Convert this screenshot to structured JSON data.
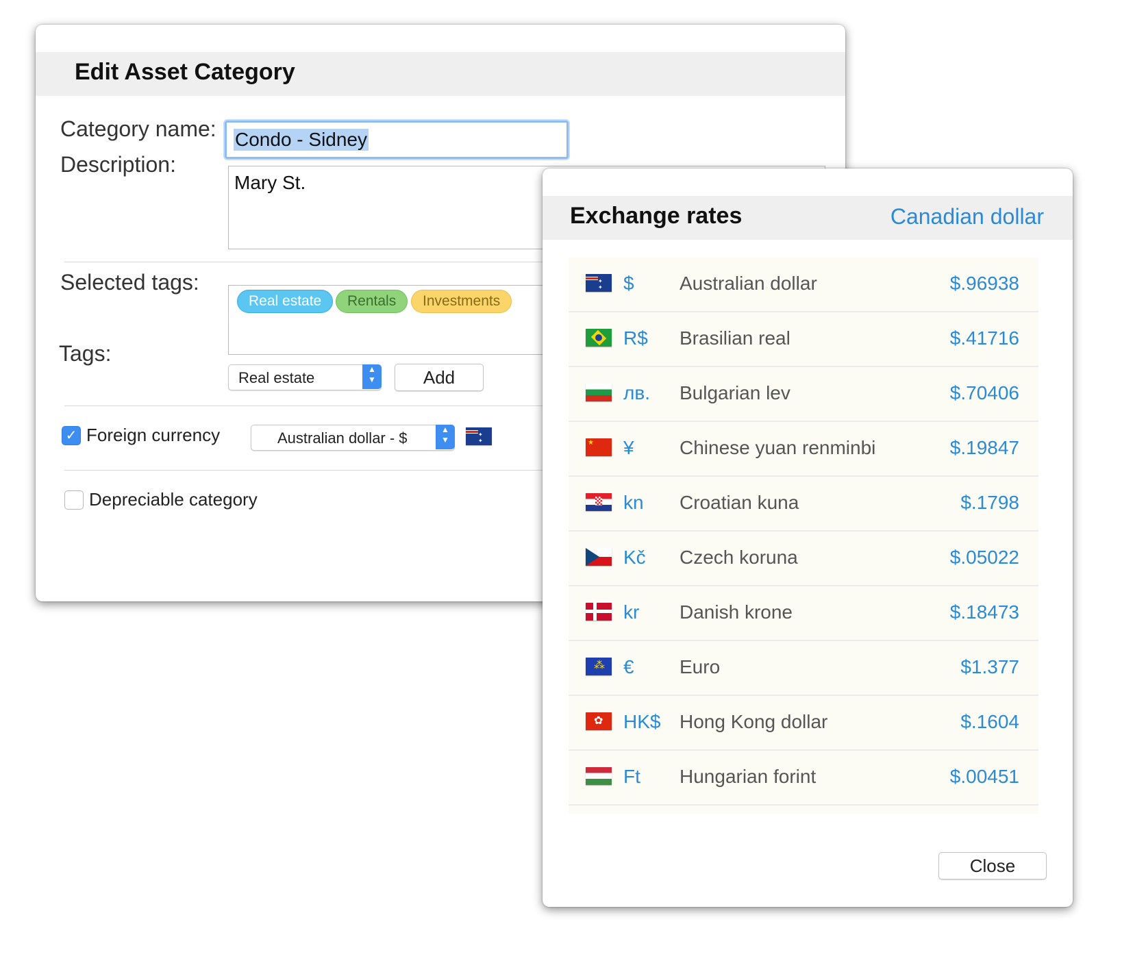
{
  "edit_dialog": {
    "title": "Edit Asset Category",
    "category_name_label": "Category name:",
    "category_name_value": "Condo - Sidney",
    "description_label": "Description:",
    "description_value": "Mary St.",
    "selected_tags_label": "Selected tags:",
    "selected_tags": [
      "Real estate",
      "Rentals",
      "Investments"
    ],
    "tags_label": "Tags:",
    "tags_select_value": "Real estate",
    "add_button": "Add",
    "foreign_currency_label": "Foreign currency",
    "foreign_currency_checked": true,
    "currency_select_value": "Australian dollar - $",
    "depreciable_label": "Depreciable category",
    "depreciable_checked": false
  },
  "rates_dialog": {
    "title": "Exchange rates",
    "base_currency": "Canadian dollar",
    "close_button": "Close",
    "rates": [
      {
        "symbol": "$",
        "name": "Australian dollar",
        "value": "$.96938",
        "flag": "australia-flag-icon"
      },
      {
        "symbol": "R$",
        "name": "Brasilian real",
        "value": "$.41716",
        "flag": "brazil-flag-icon"
      },
      {
        "symbol": "лв.",
        "name": "Bulgarian lev",
        "value": "$.70406",
        "flag": "bulgaria-flag-icon"
      },
      {
        "symbol": "¥",
        "name": "Chinese yuan renminbi",
        "value": "$.19847",
        "flag": "china-flag-icon"
      },
      {
        "symbol": "kn",
        "name": "Croatian kuna",
        "value": "$.1798",
        "flag": "croatia-flag-icon"
      },
      {
        "symbol": "Kč",
        "name": "Czech koruna",
        "value": "$.05022",
        "flag": "czech-flag-icon"
      },
      {
        "symbol": "kr",
        "name": "Danish krone",
        "value": "$.18473",
        "flag": "denmark-flag-icon"
      },
      {
        "symbol": "€",
        "name": "Euro",
        "value": "$1.377",
        "flag": "eu-flag-icon"
      },
      {
        "symbol": "HK$",
        "name": "Hong Kong dollar",
        "value": "$.1604",
        "flag": "hongkong-flag-icon"
      },
      {
        "symbol": "Ft",
        "name": "Hungarian forint",
        "value": "$.00451",
        "flag": "hungary-flag-icon"
      }
    ]
  }
}
